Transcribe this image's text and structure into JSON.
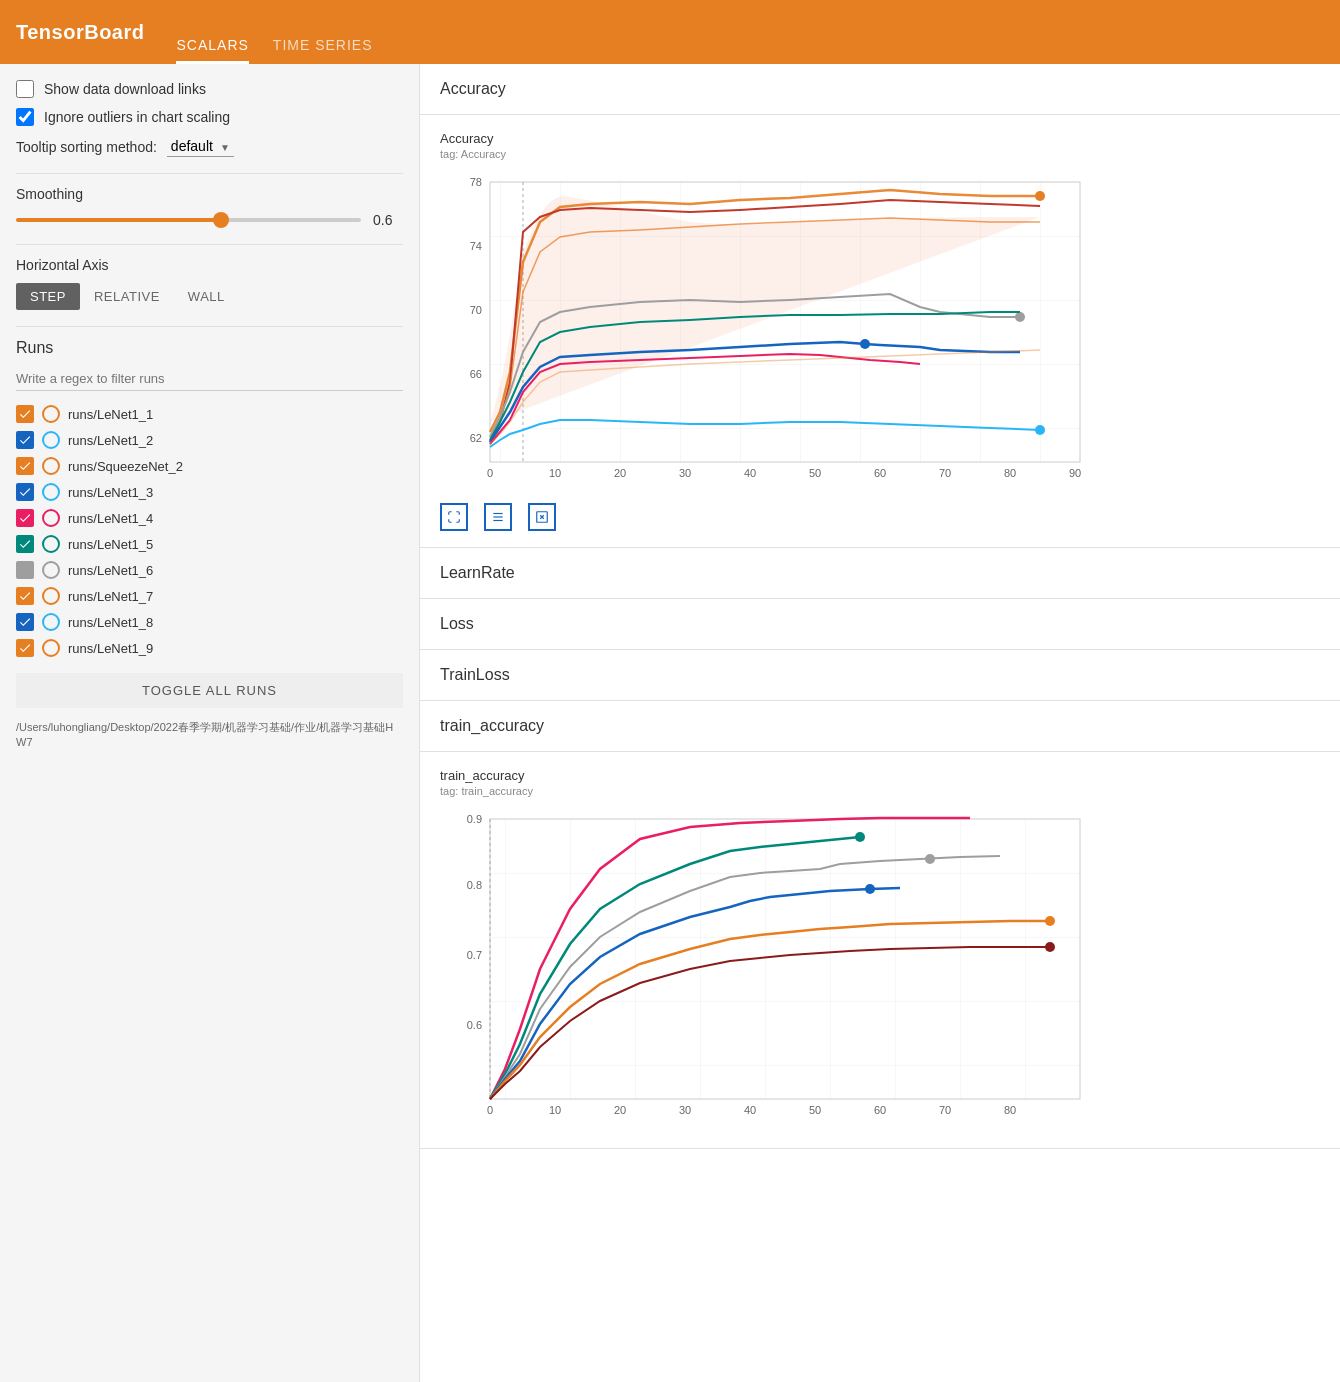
{
  "header": {
    "logo": "TensorBoard",
    "nav_items": [
      {
        "label": "SCALARS",
        "active": true
      },
      {
        "label": "TIME SERIES",
        "active": false
      }
    ]
  },
  "sidebar": {
    "show_download_label": "Show data download links",
    "ignore_outliers_label": "Ignore outliers in chart scaling",
    "show_download_checked": false,
    "ignore_outliers_checked": true,
    "tooltip_label": "Tooltip sorting method:",
    "tooltip_default": "default",
    "smoothing_label": "Smoothing",
    "smoothing_value": "0.6",
    "horizontal_axis_label": "Horizontal Axis",
    "axis_options": [
      "STEP",
      "RELATIVE",
      "WALL"
    ],
    "axis_active": "STEP",
    "runs_label": "Runs",
    "runs_filter_placeholder": "Write a regex to filter runs",
    "runs": [
      {
        "name": "runs/LeNet1_1",
        "checked": true,
        "checkbox_color": "orange",
        "circle_color": "circle-orange"
      },
      {
        "name": "runs/LeNet1_2",
        "checked": true,
        "checkbox_color": "blue",
        "circle_color": "circle-lightblue"
      },
      {
        "name": "runs/SqueezeNet_2",
        "checked": true,
        "checkbox_color": "orange",
        "circle_color": "circle-orange"
      },
      {
        "name": "runs/LeNet1_3",
        "checked": true,
        "checkbox_color": "blue",
        "circle_color": "circle-lightblue"
      },
      {
        "name": "runs/LeNet1_4",
        "checked": true,
        "checkbox_color": "pink",
        "circle_color": "circle-pink"
      },
      {
        "name": "runs/LeNet1_5",
        "checked": true,
        "checkbox_color": "teal",
        "circle_color": "circle-teal"
      },
      {
        "name": "runs/LeNet1_6",
        "checked": false,
        "checkbox_color": "gray",
        "circle_color": "circle-gray"
      },
      {
        "name": "runs/LeNet1_7",
        "checked": true,
        "checkbox_color": "orange",
        "circle_color": "circle-orange"
      },
      {
        "name": "runs/LeNet1_8",
        "checked": true,
        "checkbox_color": "blue",
        "circle_color": "circle-lightblue"
      },
      {
        "name": "runs/LeNet1_9",
        "checked": true,
        "checkbox_color": "orange",
        "circle_color": "circle-orange"
      }
    ],
    "toggle_all_label": "TOGGLE ALL RUNS",
    "footer_path": "/Users/luhongliang/Desktop/2022春季学期/机器学习基础/作业/机器学习基础HW7"
  },
  "main": {
    "sections": [
      {
        "label": "Accuracy"
      },
      {
        "label": "LearnRate"
      },
      {
        "label": "Loss"
      },
      {
        "label": "TrainLoss"
      },
      {
        "label": "train_accuracy"
      }
    ],
    "accuracy_chart": {
      "title": "Accuracy",
      "subtitle": "tag: Accuracy",
      "y_labels": [
        "78",
        "74",
        "70",
        "66",
        "62"
      ],
      "x_labels": [
        "0",
        "10",
        "20",
        "30",
        "40",
        "50",
        "60",
        "70",
        "80",
        "90"
      ]
    },
    "train_accuracy_chart": {
      "title": "train_accuracy",
      "subtitle": "tag: train_accuracy",
      "y_labels": [
        "0.9",
        "0.8",
        "0.7",
        "0.6"
      ],
      "x_labels": [
        "0",
        "10",
        "20",
        "30",
        "40",
        "50",
        "60",
        "70",
        "80"
      ]
    }
  }
}
